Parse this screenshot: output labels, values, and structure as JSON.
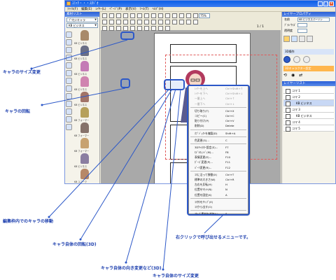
{
  "app": {
    "title": "ｺﾐｯｸ・・・ｽﾀｼﾞｵ",
    "menu": [
      "ﾌｧｲﾙ(F)",
      "編集(E)",
      "ﾚｲﾔｰ(L)",
      "ﾍﾟｰｼﾞ(P)",
      "表示(V)",
      "ﾂｰﾙ(T)",
      "ﾍﾙﾌﾟ(H)"
    ]
  },
  "left_panel": {
    "header": "素材リスト",
    "dropdown_1": "ﾌﾟﾘｾｯﾄキャラ",
    "dropdown_2": "KB ビジネス",
    "characters": [
      "KB ビジネス",
      "KB ビジネス",
      "KB ビジネス",
      "KB ビジネス",
      "KB ビジネス",
      "KB フォーマー",
      "KB フォーマー",
      "KB フォーマー",
      "KB ビジネス",
      "KB ユニーク"
    ]
  },
  "toolbar": {
    "zoom": "75%",
    "page_count": "1 / 1"
  },
  "right_panel": {
    "header": "レイヤープロパティ",
    "name_label": "名前",
    "name_value": "KB ビジネスパーソン",
    "row2_label": "ﾌﾞﾗｼ ｻｲｽﾞ",
    "row3_label": "透明度",
    "section_3d": "3D操作",
    "char_setting": "3Dキャラクター設定",
    "layer_list_header": "レイヤーリスト",
    "layers": [
      "コマ 1",
      "コマ 2",
      "KB ビジネス",
      "コマ 3",
      "KB ビジネス",
      "コマ 4",
      "コマ 5"
    ]
  },
  "context_menu": {
    "items": [
      {
        "label": "ﾚｲﾔｰを上へ",
        "shortcut": "Ctrl+Shift+↑",
        "disabled": true
      },
      {
        "label": "ﾚｲﾔｰを下へ",
        "shortcut": "Ctrl+Shift+↓",
        "disabled": true
      },
      {
        "label": "一番上へ",
        "shortcut": "Ctrl+↑",
        "disabled": true
      },
      {
        "label": "一番下へ",
        "shortcut": "Ctrl+↓",
        "disabled": true
      },
      {
        "sep": true
      },
      {
        "label": "切り取り(T)",
        "shortcut": "Ctrl+X"
      },
      {
        "label": "コピー(C)",
        "shortcut": "Ctrl+C"
      },
      {
        "label": "貼り付け(P)",
        "shortcut": "Ctrl+V"
      },
      {
        "label": "削除(D)",
        "shortcut": "Delete"
      },
      {
        "sep": true
      },
      {
        "label": "ｵﾌﾞｼﾞｪｸﾄを複製(D)",
        "shortcut": "Shift+A"
      },
      {
        "sep": true
      },
      {
        "label": "色変更(G)...",
        "shortcut": "C"
      },
      {
        "sep": true
      },
      {
        "label": "3Dｷｬﾗｸﾀｰ設定(S)...",
        "shortcut": "F7"
      },
      {
        "label": "ﾓﾃﾞﾙﾁｪﾝｼﾞ(M)...",
        "shortcut": "F8"
      },
      {
        "label": "表情変更(E)...",
        "shortcut": "F10"
      },
      {
        "label": "ﾎﾟｰｽﾞ変更(P)...",
        "shortcut": "F11"
      },
      {
        "label": "ﾊﾟｰﾂ変更(R)...",
        "shortcut": "F12"
      },
      {
        "sep": true
      },
      {
        "label": "ｺﾏに沿って移動(X)",
        "shortcut": "Ctrl+T"
      },
      {
        "label": "標準の大きさ(W)",
        "shortcut": "Ctrl+R"
      },
      {
        "label": "左右を反転(H)",
        "shortcut": "H"
      },
      {
        "label": "位置をﾘｾｯﾄ(N)",
        "shortcut": "N"
      },
      {
        "label": "位置を固定(K)",
        "shortcut": "A"
      },
      {
        "sep": true
      },
      {
        "label": "ｺﾏ外をｸﾘｯﾌﾟ(E)",
        "shortcut": ""
      },
      {
        "label": "ｺﾏから出す(O)",
        "shortcut": ""
      },
      {
        "sep": true
      },
      {
        "label": "ｽﾀｯﾌﾟ素材を追加(L)...",
        "shortcut": "S"
      }
    ]
  },
  "annotations": {
    "size": "キャラのサイズ変更",
    "rotate": "キャラの回転",
    "move": "編集枠内でのキャラの移動",
    "rotate3d": "キャラ自体の回転(3D)",
    "orient3d": "キャラ自体の向き変更など(3D)",
    "resize_char": "キャラ自体のサイズ変更",
    "menu": "右クリックで呼び出せるメニューです。"
  },
  "colors": {
    "annotation": "#1d3fae",
    "highlight": "#2c58c8"
  }
}
